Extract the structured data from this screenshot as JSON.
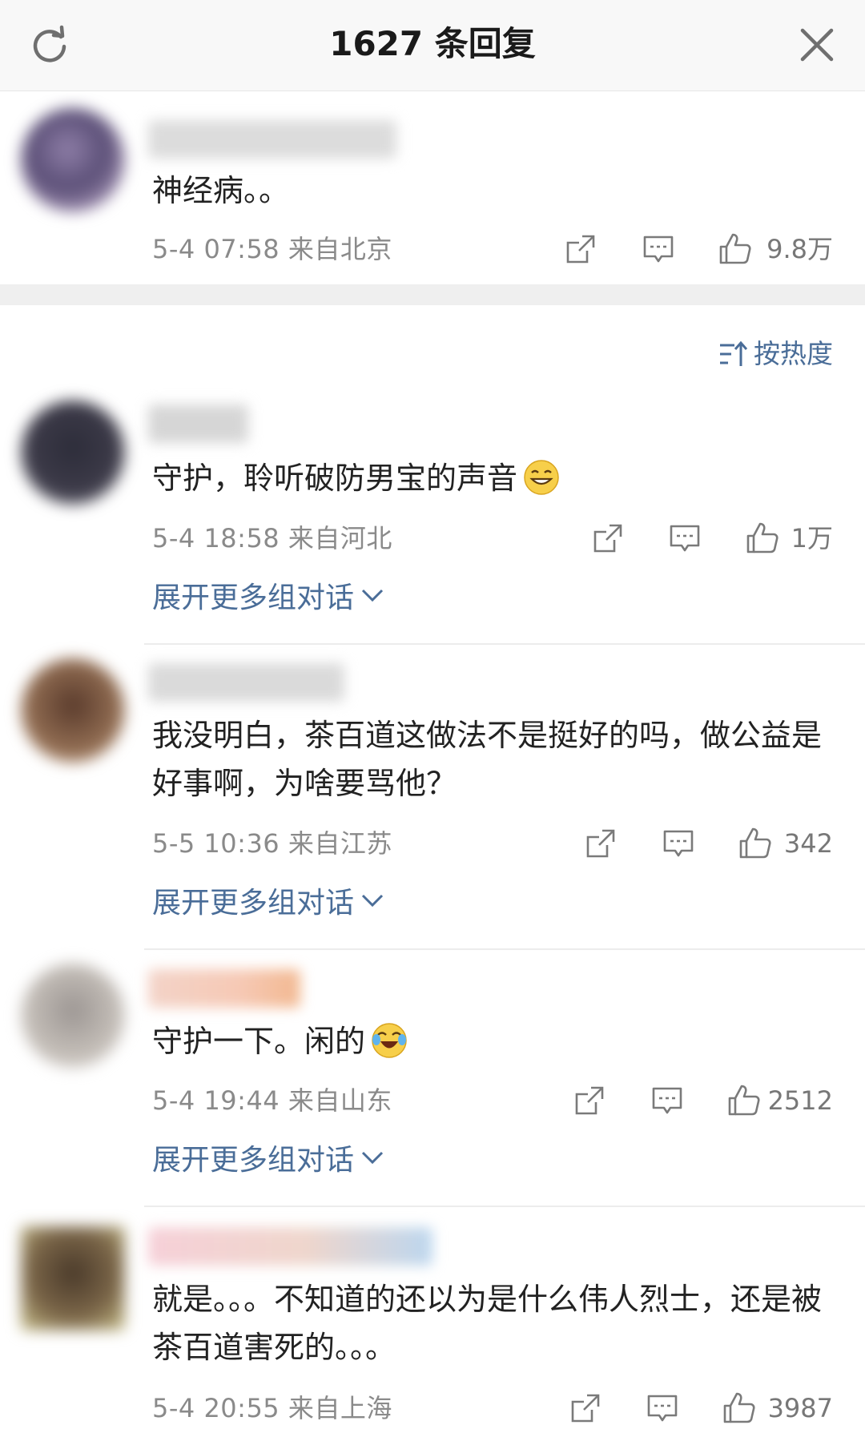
{
  "header": {
    "title": "1627 条回复"
  },
  "icons": {
    "refresh": "refresh-icon",
    "close": "close-icon",
    "share": "share-icon",
    "reply": "comment-icon",
    "like": "thumbs-up-icon",
    "sort": "sort-icon",
    "expand": "chevron-down-icon"
  },
  "colors": {
    "link": "#4a6d98",
    "meta": "#8a8a8a",
    "text": "#222222"
  },
  "sort": {
    "label": "按热度"
  },
  "expand_label": "展开更多组对话",
  "comments": [
    {
      "text": "神经病。。",
      "time": "5-4 07:58",
      "location": "来自北京",
      "likes": "9.8万"
    },
    {
      "text": "守护，聆听破防男宝的声音",
      "emoji": "grinning-face-emoji",
      "time": "5-4 18:58",
      "location": "来自河北",
      "likes": "1万"
    },
    {
      "text": "我没明白，茶百道这做法不是挺好的吗，做公益是好事啊，为啥要骂他？",
      "time": "5-5 10:36",
      "location": "来自江苏",
      "likes": "342"
    },
    {
      "text": "守护一下。闲的",
      "emoji": "crying-laughing-emoji",
      "time": "5-4 19:44",
      "location": "来自山东",
      "likes": "2512"
    },
    {
      "text": "就是。。。不知道的还以为是什么伟人烈士，还是被茶百道害死的。。。",
      "time": "5-4 20:55",
      "location": "来自上海",
      "likes": "3987"
    }
  ]
}
